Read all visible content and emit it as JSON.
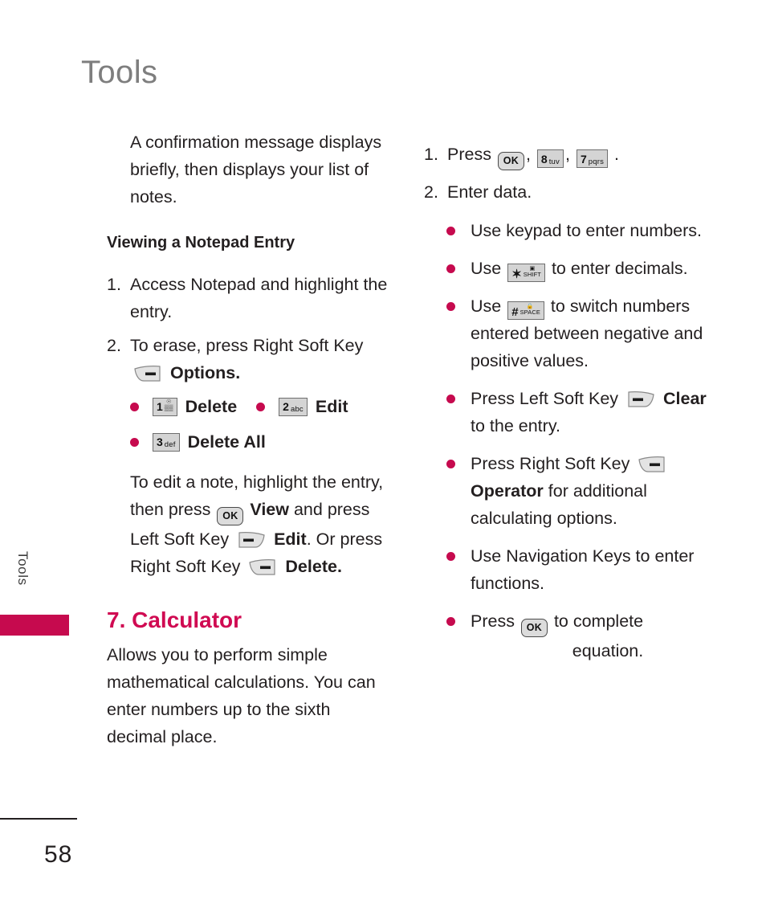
{
  "page": {
    "title": "Tools",
    "side_tab_label": "Tools",
    "number": "58",
    "accent_color": "#c60a4e",
    "heading_color": "#d00a52",
    "title_color": "#7e7e7e"
  },
  "left_column": {
    "intro_paragraph": "A confirmation message displays briefly, then displays your list of notes.",
    "subheading": "Viewing a Notepad Entry",
    "steps": [
      {
        "number": "1.",
        "text": "Access Notepad and highlight the entry."
      },
      {
        "number": "2.",
        "text_before": "To erase, press Right Soft Key",
        "key": "right-soft-key",
        "text_after": "Options."
      }
    ],
    "option_bullets": [
      {
        "key_digit": "1",
        "key_sub": "voicemail-icon",
        "label": "Delete"
      },
      {
        "key_digit": "2",
        "key_sub": "abc",
        "label": "Edit"
      },
      {
        "key_digit": "3",
        "key_sub": "def",
        "label": "Delete All"
      }
    ],
    "edit_note_paragraph": {
      "part1": "To edit a note, highlight the entry, then press",
      "key1": "ok-key",
      "bold1": "View",
      "part2": "and press Left Soft Key",
      "key2": "left-soft-key",
      "bold2": "Edit",
      "part3": ". Or press Right Soft Key",
      "key3": "right-soft-key",
      "bold3": "Delete."
    },
    "section_heading": "7. Calculator",
    "section_paragraph": "Allows you to perform simple mathematical calculations. You can enter numbers up to the sixth decimal place."
  },
  "right_column": {
    "steps": [
      {
        "number": "1.",
        "text_before": "Press",
        "keys": [
          {
            "type": "ok",
            "label": "OK"
          },
          {
            "type": "digit",
            "digit": "8",
            "sub": "tuv"
          },
          {
            "type": "digit",
            "digit": "7",
            "sub": "pqrs"
          }
        ],
        "text_after": "."
      },
      {
        "number": "2.",
        "text": "Enter data."
      }
    ],
    "bullets": [
      {
        "text": "Use keypad to enter numbers."
      },
      {
        "text_before": "Use",
        "key": {
          "type": "star",
          "sym": "✶",
          "mini_icon": "camera-icon",
          "mini_label": "SHIFT"
        },
        "text_after": "to enter decimals."
      },
      {
        "text_before": "Use",
        "key": {
          "type": "pound",
          "sym": "#",
          "mini_icon": "lock-icon",
          "mini_label": "SPACE"
        },
        "text_after": "to switch numbers entered between negative and positive values."
      },
      {
        "text_before": "Press Left Soft Key",
        "key": {
          "type": "left-soft-key"
        },
        "bold": "Clear",
        "text_after": "to the entry."
      },
      {
        "text_before": "Press Right Soft Key",
        "key": {
          "type": "right-soft-key"
        },
        "bold": "Operator",
        "text_after": "for additional calculating options."
      },
      {
        "text": "Use Navigation Keys to enter functions."
      },
      {
        "text_before": "Press",
        "key": {
          "type": "ok",
          "label": "OK"
        },
        "text_after": "to complete",
        "text_after2": "equation."
      }
    ]
  }
}
